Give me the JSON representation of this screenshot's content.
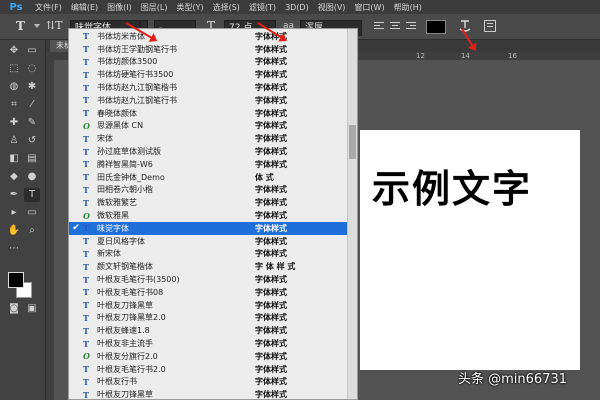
{
  "app": {
    "logo": "Ps",
    "menu": [
      "文件(F)",
      "编辑(E)",
      "图像(I)",
      "图层(L)",
      "类型(Y)",
      "选择(S)",
      "滤镜(T)",
      "3D(D)",
      "视图(V)",
      "窗口(W)",
      "帮助(H)"
    ]
  },
  "options_bar": {
    "tool_icon": "T",
    "orientation_icon": "⇅T",
    "font_family": "味觉字体",
    "font_style": "-",
    "font_size": "72 点",
    "aa_label": "aa",
    "anti_alias": "浑厚",
    "text_color": "#000000"
  },
  "tab": {
    "label": "未标"
  },
  "ruler": {
    "labels": [
      "12",
      "14",
      "16"
    ]
  },
  "canvas": {
    "sample_text": "示例文字"
  },
  "font_list": {
    "items": [
      {
        "name": "书体坊米芾体",
        "sample": "字体样式",
        "type": "T",
        "selected": false
      },
      {
        "name": "书体坊王学勤钢笔行书",
        "sample": "字体样式",
        "type": "T",
        "selected": false
      },
      {
        "name": "书体坊颜体3500",
        "sample": "字体样式",
        "type": "T",
        "selected": false
      },
      {
        "name": "书体坊硬笔行书3500",
        "sample": "字体样式",
        "type": "T",
        "selected": false
      },
      {
        "name": "书体坊赵九江钢笔楷书",
        "sample": "字体样式",
        "type": "T",
        "selected": false
      },
      {
        "name": "书体坊赵九江钢笔行书",
        "sample": "字体样式",
        "type": "T",
        "selected": false
      },
      {
        "name": "春晓体颜体",
        "sample": "字体样式",
        "type": "T",
        "selected": false
      },
      {
        "name": "思源黑体 CN",
        "sample": "字体样式",
        "type": "O",
        "selected": false
      },
      {
        "name": "宋体",
        "sample": "字体样式",
        "type": "T",
        "selected": false
      },
      {
        "name": "孙过庭草体测试版",
        "sample": "字体样式",
        "type": "T",
        "selected": false
      },
      {
        "name": "腾祥智黑简-W6",
        "sample": "字体样式",
        "type": "T",
        "selected": false
      },
      {
        "name": "田氏金钟体_Demo",
        "sample": "体 式",
        "type": "T",
        "selected": false
      },
      {
        "name": "田相卷六朝小楷",
        "sample": "字体样式",
        "type": "T",
        "selected": false
      },
      {
        "name": "微软雅繁艺",
        "sample": "字体样式",
        "type": "T",
        "selected": false
      },
      {
        "name": "微软雅黑",
        "sample": "字体样式",
        "type": "O",
        "selected": false
      },
      {
        "name": "味觉字体",
        "sample": "字体样式",
        "type": "T",
        "selected": true
      },
      {
        "name": "夏日风格字体",
        "sample": "字体样式",
        "type": "T",
        "selected": false
      },
      {
        "name": "新宋体",
        "sample": "字体样式",
        "type": "T",
        "selected": false
      },
      {
        "name": "颜文轩钢笔楷体",
        "sample": "字 体 样 式",
        "type": "T",
        "selected": false
      },
      {
        "name": "叶根友毛笔行书(3500)",
        "sample": "字体样式",
        "type": "T",
        "selected": false
      },
      {
        "name": "叶根友毛笔行书08",
        "sample": "字体样式",
        "type": "T",
        "selected": false
      },
      {
        "name": "叶根友刀锋黑草",
        "sample": "字体样式",
        "type": "T",
        "selected": false
      },
      {
        "name": "叶根友刀锋黑草2.0",
        "sample": "字体样式",
        "type": "T",
        "selected": false
      },
      {
        "name": "叶根友蜂速1.8",
        "sample": "字体样式",
        "type": "T",
        "selected": false
      },
      {
        "name": "叶根友非主流手",
        "sample": "字体样式",
        "type": "T",
        "selected": false
      },
      {
        "name": "叶根友分旗行2.0",
        "sample": "字体样式",
        "type": "O",
        "selected": false
      },
      {
        "name": "叶根友毛笔行书2.0",
        "sample": "字体样式",
        "type": "T",
        "selected": false
      },
      {
        "name": "叶根友行书",
        "sample": "字体样式",
        "type": "T",
        "selected": false
      },
      {
        "name": "叶根友刀锋黑草",
        "sample": "字体样式",
        "type": "T",
        "selected": false
      }
    ]
  },
  "watermark": "头条 @min66731"
}
